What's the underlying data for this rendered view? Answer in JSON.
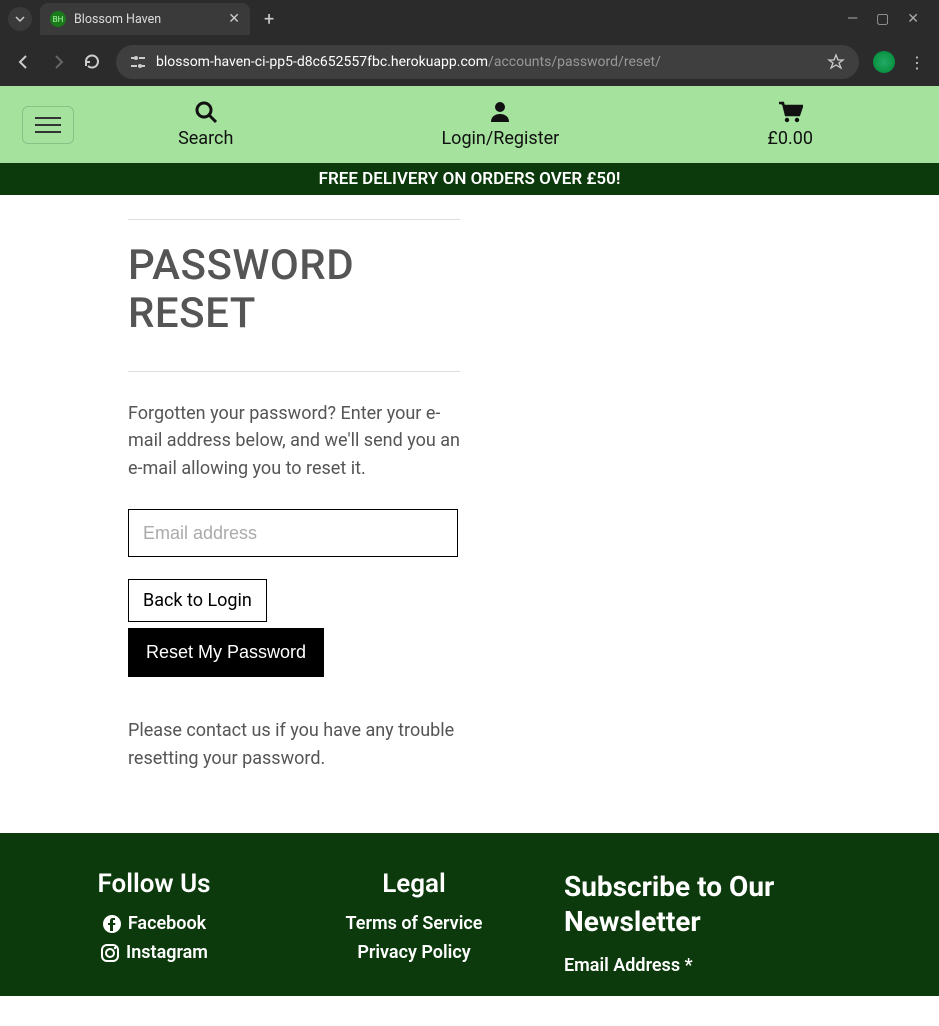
{
  "browser": {
    "tab_title": "Blossom Haven",
    "url_main": "blossom-haven-ci-pp5-d8c652557fbc.herokuapp.com",
    "url_path": "/accounts/password/reset/"
  },
  "header": {
    "search_label": "Search",
    "login_label": "Login/Register",
    "cart_label": "£0.00"
  },
  "banner": {
    "text": "FREE DELIVERY ON ORDERS OVER £50!"
  },
  "main": {
    "title": "PASSWORD RESET",
    "instructions": "Forgotten your password? Enter your e-mail address below, and we'll send you an e-mail allowing you to reset it.",
    "email_placeholder": "Email address",
    "back_button": "Back to Login",
    "reset_button": "Reset My Password",
    "contact_text": "Please contact us if you have any trouble resetting your password."
  },
  "footer": {
    "follow_heading": "Follow Us",
    "facebook": "Facebook",
    "instagram": "Instagram",
    "legal_heading": "Legal",
    "terms": "Terms of Service",
    "privacy": "Privacy Policy",
    "newsletter_heading": "Subscribe to Our Newsletter",
    "email_label": "Email Address *"
  }
}
